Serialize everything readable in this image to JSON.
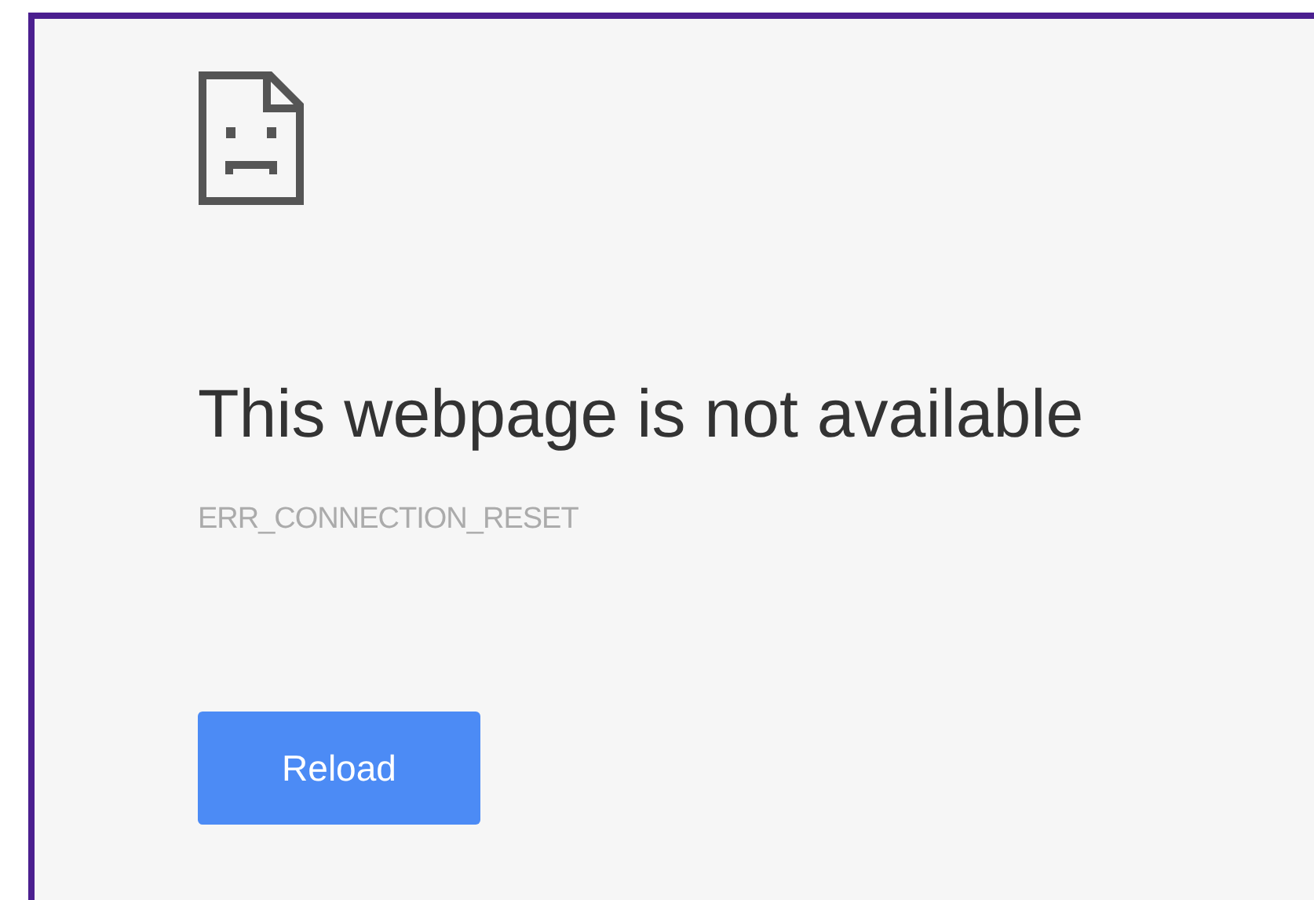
{
  "error": {
    "title": "This webpage is not available",
    "code": "ERR_CONNECTION_RESET"
  },
  "buttons": [
    {
      "label": "Reload",
      "kind": "primary"
    }
  ]
}
